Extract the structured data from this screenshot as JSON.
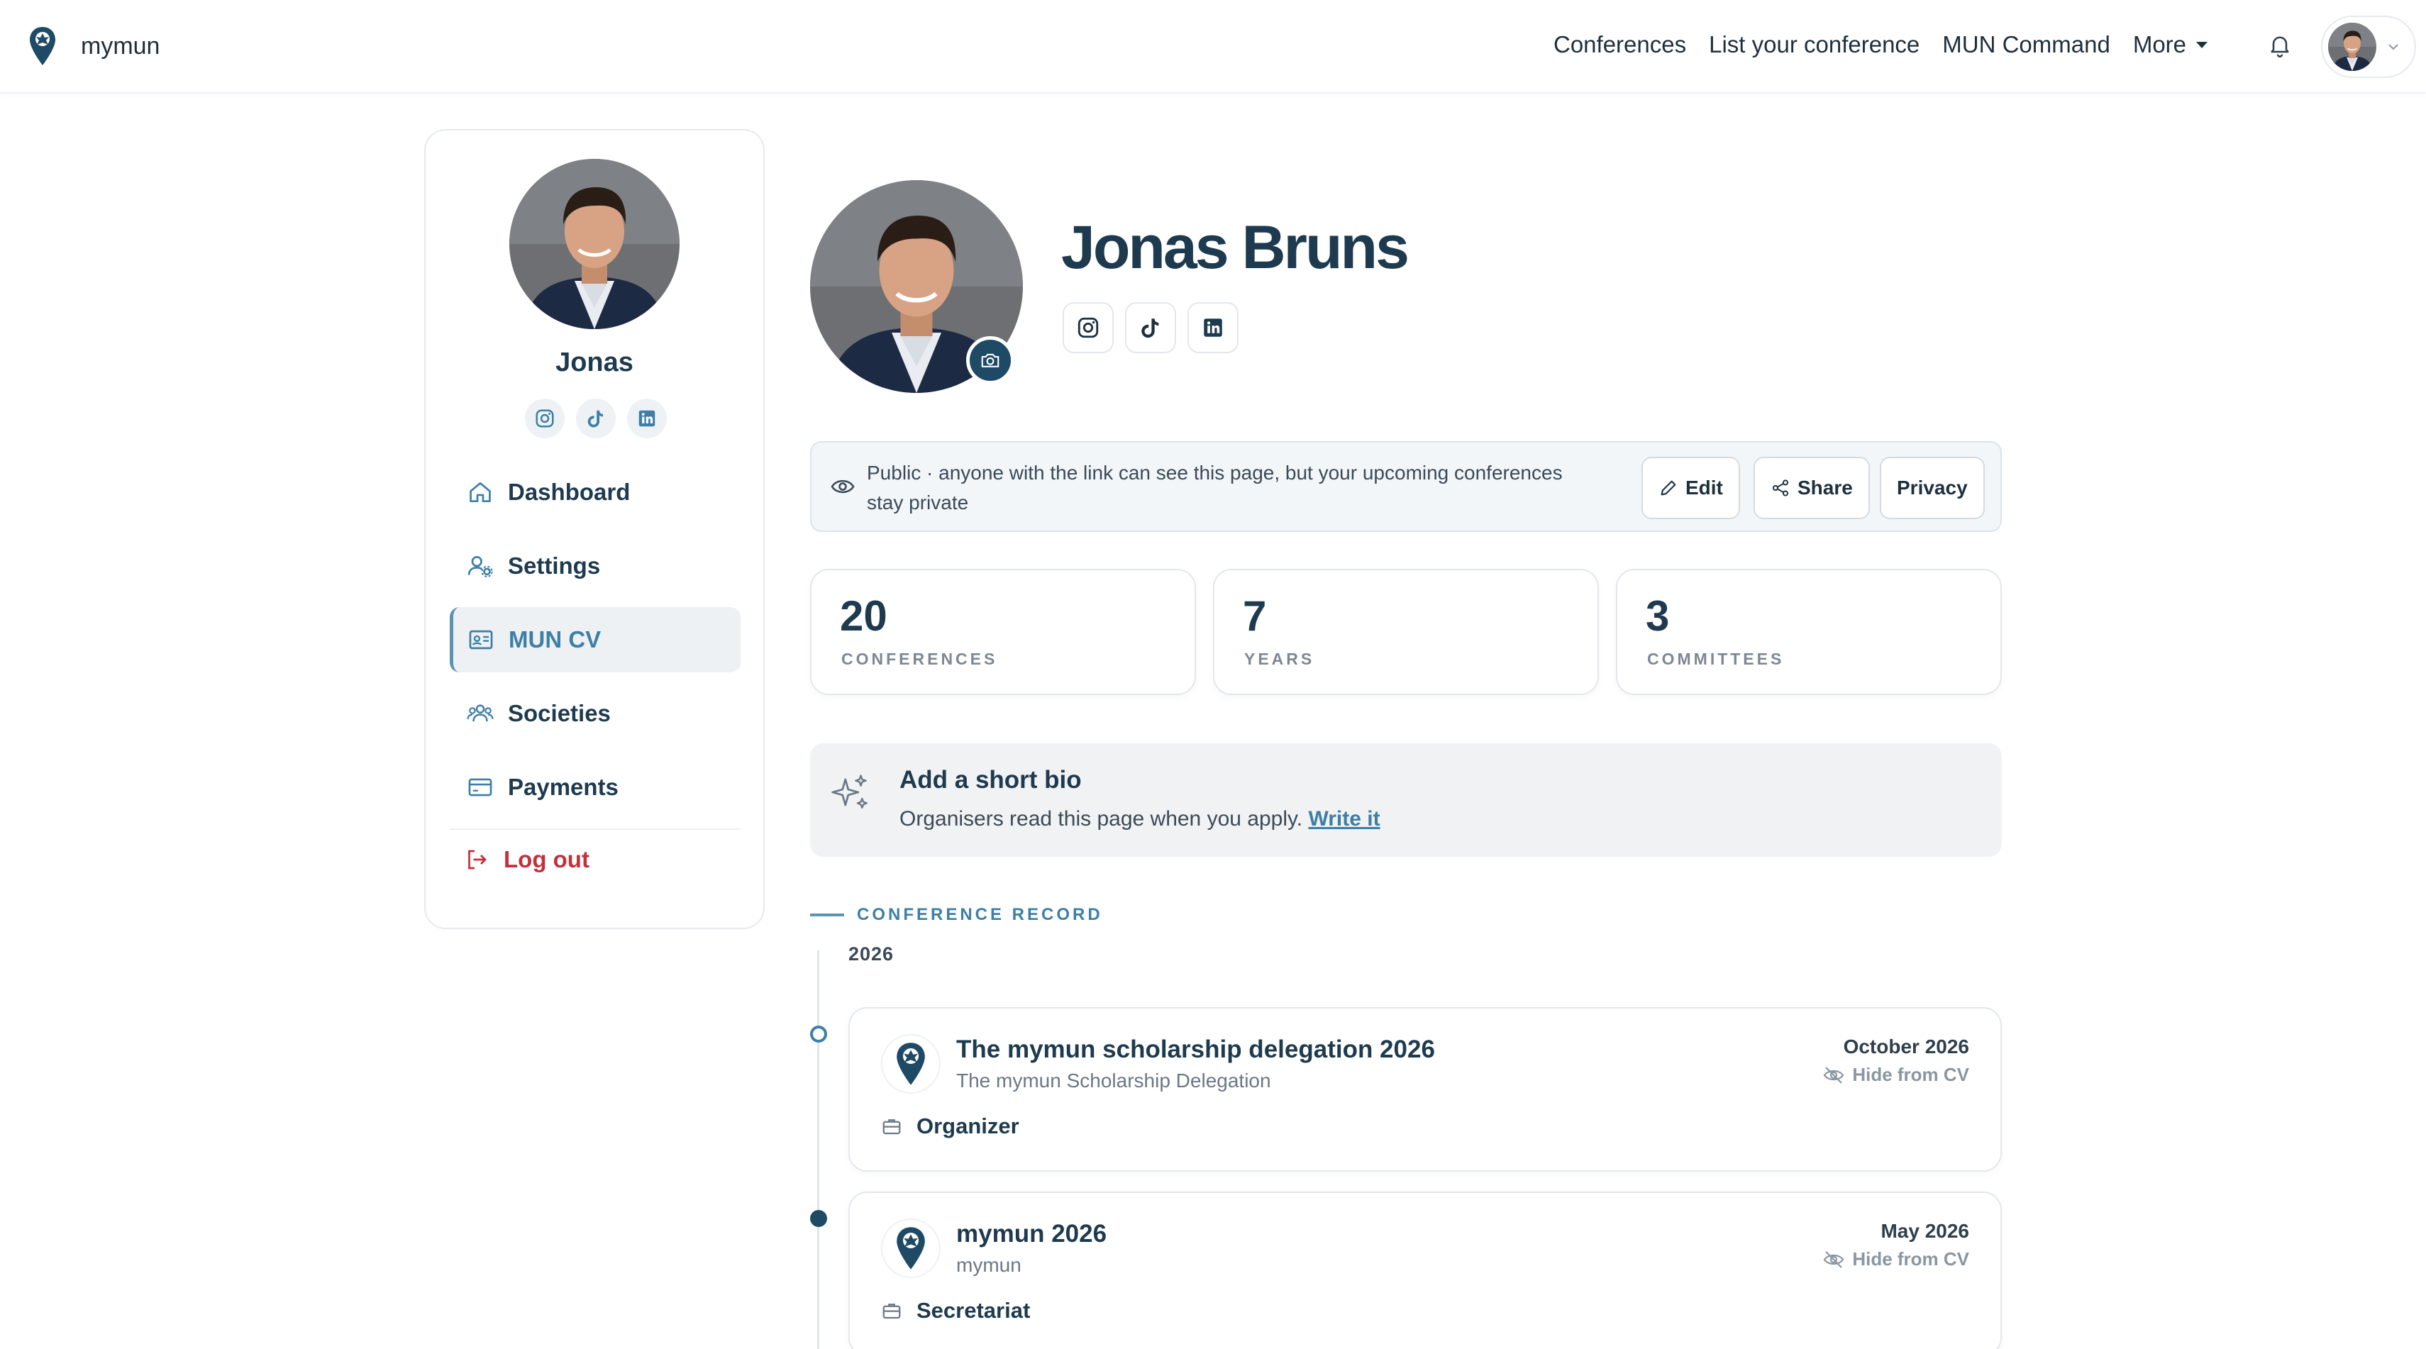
{
  "nav": {
    "brand": "mymun",
    "links": [
      "Conferences",
      "List your conference",
      "MUN Command"
    ],
    "more_label": "More",
    "icons": [
      "bell-icon",
      "chevron-down-icon"
    ]
  },
  "sidebar": {
    "name": "Jonas",
    "items": [
      {
        "label": "Dashboard",
        "icon": "home-icon"
      },
      {
        "label": "Settings",
        "icon": "user-settings-icon"
      },
      {
        "label": "MUN CV",
        "icon": "id-card-icon"
      },
      {
        "label": "Societies",
        "icon": "users-icon"
      },
      {
        "label": "Payments",
        "icon": "credit-card-icon"
      }
    ],
    "active_item": "MUN CV",
    "logout_label": "Log out"
  },
  "profile": {
    "name": "Jonas Bruns",
    "socials": [
      "instagram-icon",
      "tiktok-icon",
      "linkedin-icon"
    ]
  },
  "visibility": {
    "text": "Public · anyone with the link can see this page, but your upcoming conferences stay private",
    "edit_label": "Edit",
    "share_label": "Share",
    "privacy_label": "Privacy"
  },
  "stats": [
    {
      "value": "20",
      "label": "CONFERENCES"
    },
    {
      "value": "7",
      "label": "YEARS"
    },
    {
      "value": "3",
      "label": "COMMITTEES"
    }
  ],
  "bio": {
    "title": "Add a short bio",
    "text": "Organisers read this page when you apply.",
    "link": "Write it"
  },
  "record": {
    "heading": "CONFERENCE RECORD",
    "year": "2026",
    "hide_label": "Hide from CV",
    "conferences": [
      {
        "title": "The mymun scholarship delegation 2026",
        "subtitle": "The mymun Scholarship Delegation",
        "role": "Organizer",
        "date": "October 2026"
      },
      {
        "title": "mymun 2026",
        "subtitle": "mymun",
        "role": "Secretariat",
        "date": "May 2026"
      }
    ]
  },
  "colors": {
    "accent": "#3d7fa6",
    "primary_text": "#1e3a4f",
    "danger": "#c2303b"
  }
}
